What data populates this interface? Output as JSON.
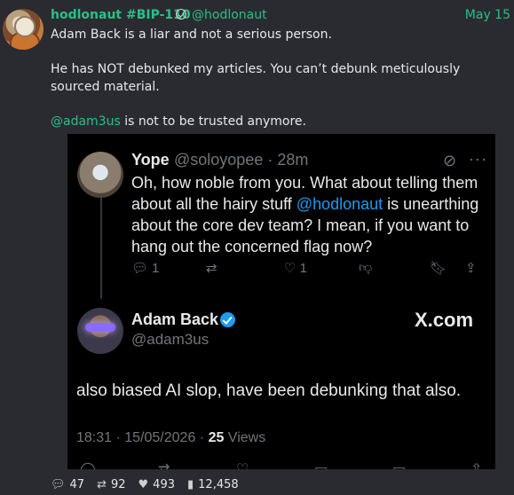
{
  "post": {
    "author": "hodlonaut #BIP-110",
    "handle": "@hodlonaut",
    "date": "May 15",
    "line1": "Adam Back is a liar and not a serious person.",
    "line2": "He has NOT debunked my articles. You can’t debunk meticulously sourced material.",
    "mention": "@adam3us",
    "line3_rest": " is not to be trusted anymore."
  },
  "embed": {
    "quoted": {
      "name": "Yope",
      "handle_time": "@soloyopee · 28m",
      "text_before": "Oh, how noble from you. What about telling them about all the hairy stuff ",
      "link": "@hodlonaut",
      "text_after": " is unearthing about the core dev team? I mean, if you want to hang out the concerned flag now?",
      "replies": "1",
      "likes": "1"
    },
    "reply": {
      "name": "Adam Back",
      "handle": "@adam3us",
      "brand": "X.com",
      "text": "also biased AI slop, have been debunking that also.",
      "timestamp": "18:31 · 15/05/2026 · ",
      "views_count": "25",
      "views_label": " Views"
    }
  },
  "stats": {
    "replies": "47",
    "reposts": "92",
    "likes": "493",
    "views": "12,458"
  },
  "colors": {
    "accent": "#27c08a",
    "link": "#1d9bf0",
    "background": "#2a2b30"
  }
}
